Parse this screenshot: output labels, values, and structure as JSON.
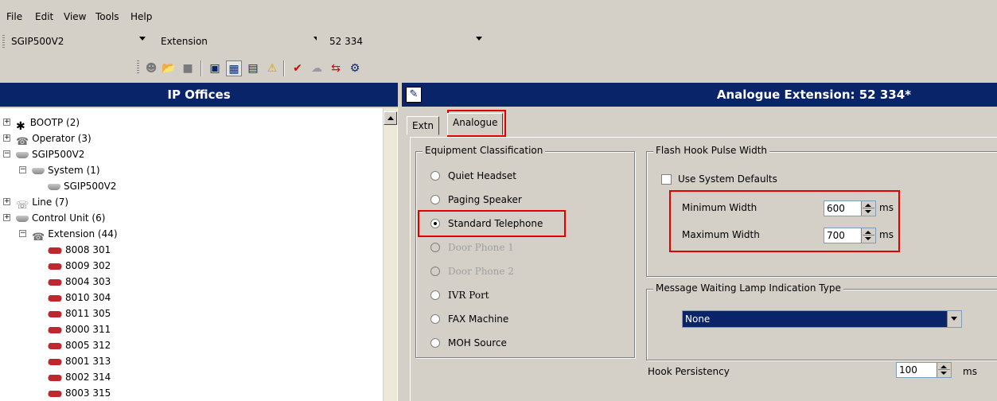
{
  "menu": {
    "file": "File",
    "edit": "Edit",
    "view": "View",
    "tools": "Tools",
    "help": "Help"
  },
  "selectors": {
    "system": "SGIP500V2",
    "type": "Extension",
    "item": "52 334"
  },
  "left_panel": {
    "title": "IP Offices",
    "tree": [
      {
        "label": "BOOTP (2)",
        "icon": "bootp-icon",
        "expander": "+"
      },
      {
        "label": "Operator (3)",
        "icon": "operator-icon",
        "expander": "+"
      },
      {
        "label": "SGIP500V2",
        "icon": "server-icon",
        "expander": "-"
      },
      {
        "label": "System (1)",
        "icon": "server-icon",
        "expander": "-"
      },
      {
        "label": "SGIP500V2",
        "icon": "server-icon",
        "expander": ""
      },
      {
        "label": "Line (7)",
        "icon": "line-icon",
        "expander": "+"
      },
      {
        "label": "Control Unit (6)",
        "icon": "control-unit-icon",
        "expander": "+"
      },
      {
        "label": "Extension (44)",
        "icon": "extension-icon",
        "expander": "-"
      },
      {
        "label": "8008 301",
        "icon": "analogue-phone-icon",
        "expander": ""
      },
      {
        "label": "8009 302",
        "icon": "analogue-phone-icon",
        "expander": ""
      },
      {
        "label": "8004 303",
        "icon": "analogue-phone-icon",
        "expander": ""
      },
      {
        "label": "8010 304",
        "icon": "analogue-phone-icon",
        "expander": ""
      },
      {
        "label": "8011 305",
        "icon": "analogue-phone-icon",
        "expander": ""
      },
      {
        "label": "8000 311",
        "icon": "analogue-phone-icon",
        "expander": ""
      },
      {
        "label": "8005 312",
        "icon": "analogue-phone-icon",
        "expander": ""
      },
      {
        "label": "8001 313",
        "icon": "analogue-phone-icon",
        "expander": ""
      },
      {
        "label": "8002 314",
        "icon": "analogue-phone-icon",
        "expander": ""
      },
      {
        "label": "8003 315",
        "icon": "analogue-phone-icon",
        "expander": ""
      }
    ]
  },
  "right_panel": {
    "title": "Analogue Extension: 52 334*",
    "tabs": [
      "Extn",
      "Analogue"
    ],
    "equipment": {
      "title": "Equipment Classification",
      "options": [
        {
          "label": "Quiet Headset",
          "checked": false,
          "disabled": false
        },
        {
          "label": "Paging Speaker",
          "checked": false,
          "disabled": false
        },
        {
          "label": "Standard Telephone",
          "checked": true,
          "disabled": false
        },
        {
          "label": "Door Phone 1",
          "checked": false,
          "disabled": true
        },
        {
          "label": "Door Phone 2",
          "checked": false,
          "disabled": true
        },
        {
          "label": "IVR Port",
          "checked": false,
          "disabled": false
        },
        {
          "label": "FAX Machine",
          "checked": false,
          "disabled": false
        },
        {
          "label": "MOH Source",
          "checked": false,
          "disabled": false
        }
      ]
    },
    "flash_hook": {
      "title": "Flash Hook Pulse Width",
      "use_defaults_label": "Use System Defaults",
      "use_defaults_checked": false,
      "min_label": "Minimum Width",
      "min_value": "600",
      "max_label": "Maximum Width",
      "max_value": "700",
      "unit": "ms"
    },
    "mwi": {
      "title": "Message Waiting Lamp Indication Type",
      "value": "None"
    },
    "hook_persistency": {
      "label": "Hook Persistency",
      "value": "100",
      "unit": "ms"
    }
  },
  "colors": {
    "header_bg": "#0a246a",
    "highlight": "#e00000",
    "chrome": "#d4d0c8"
  }
}
